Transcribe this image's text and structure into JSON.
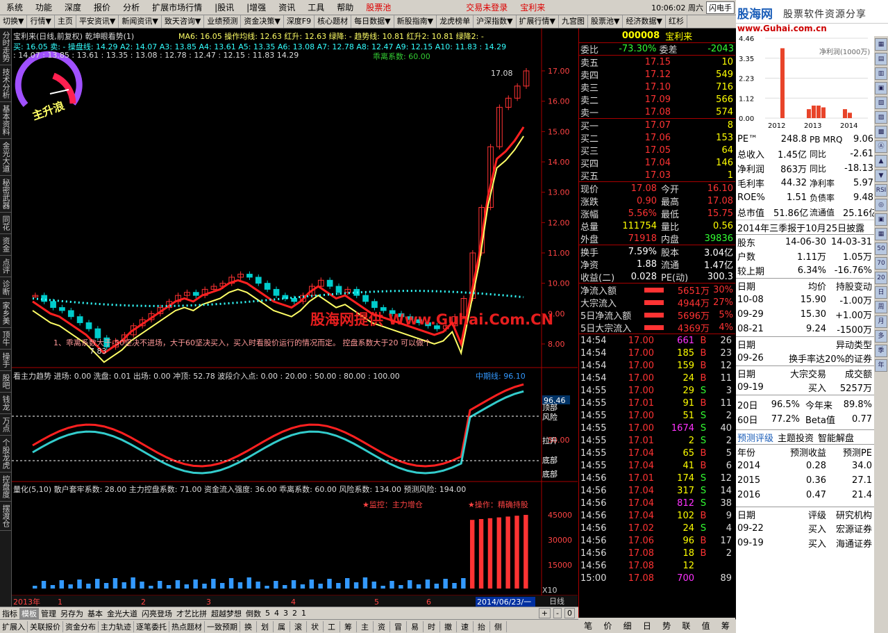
{
  "menu": [
    "系统",
    "功能",
    "深度",
    "报价",
    "分析",
    "扩展市场行情",
    "|股讯",
    "|增强",
    "资讯",
    "工具",
    "帮助"
  ],
  "menu_red": "股票池",
  "menu_login": "交易未登录",
  "menu_stock": "宝利来",
  "clock": "10:06:02 周六",
  "flash": "闪电手",
  "tabs": [
    "切换▼",
    "行情▼",
    "主页",
    "平安资讯▼",
    "新闻资讯▼",
    "致天咨询▼",
    "业绩预测",
    "资金决策▼",
    "深度F9",
    "核心题材",
    "每日数据▼",
    "新股指南▼",
    "龙虎榜单",
    "沪深指数▼",
    "扩展行情▼",
    "九宫图",
    "股票池▼",
    "经济数据▼",
    "红杉"
  ],
  "leftbar": [
    "分时走势",
    "技术分析",
    "基本资料",
    "金光大道",
    "秘密武器",
    "同花",
    "资金",
    "点评",
    "诊断",
    "家乡美",
    "顶牛",
    "操手",
    "股吧",
    "钱龙",
    "万点",
    "个股龙虎",
    "控盘度",
    "摆渡仓"
  ],
  "chart": {
    "title": "宝利来(日线,前复权) 乾坤眼看势(1)",
    "ma_line": "MA6: 16.05  操作均线: 12.63  红升: 12.63  绿降: -  趋势线: 10.81  红升2: 10.81  绿降2: -",
    "line2": "买: 16.05  卖: -   操盘线: 14.29  A2: 14.07  A3: 13.85  A4: 13.61  A5: 13.35  A6: 13.08  A7: 12.78  A8: 12.47  A9: 12.15  A10: 11.83  : 14.29",
    "line3": ": 14.07 : 13.85 : 13.61 : 13.35 : 13.08 : 12.78 : 12.47 : 12.15 : 11.83  14.29",
    "line4": "乖离系数: 60.00",
    "gauge": "主升浪",
    "hi_label": "17.08",
    "lo_label": "7.83",
    "note": "1、乖离系数大于-50坚决不进场，大于60坚决买入，买入时看股价运行的情况而定。    控盘系数大于20 可以做个",
    "watermark": "股海网提供 Www.Guhai.Com.CN",
    "yaxis": [
      "17.00",
      "16.00",
      "15.00",
      "14.00",
      "13.00",
      "12.00",
      "11.00",
      "10.00",
      "9.00",
      "8.00"
    ],
    "ind1": "看主力趋势   进场: 0.00   洗盘: 0.01   出场: 0.00   冲顶: 52.78   波段介入点: 0.00   : 20.00   : 50.00   : 80.00   : 100.00",
    "ind1_right": "中期线: 96.10",
    "ind1_y": [
      "96.46",
      "50.00"
    ],
    "ind1_labels": [
      "顶部",
      "风险",
      "拉升",
      "底部",
      "底部"
    ],
    "ind2": "量化(5,10)  散户套牢系数: 28.00  主力控盘系数: 71.00  资金流入强度: 36.00  乖离系数: 60.00          风险系数: 134.00  预测风险: 194.00",
    "ind2_watch": "★监控：主力增仓",
    "ind2_op": "★操作：精确持股",
    "ind2_y": [
      "45000",
      "30000",
      "15000"
    ],
    "ind2_x10": "X10",
    "dates": [
      "2013年",
      "1",
      "2",
      "3",
      "4",
      "5",
      "6"
    ],
    "date_hl": "2014/06/23/一",
    "period": "日线"
  },
  "bottom_tabs": [
    "指标",
    "模板",
    "管理",
    "另存为",
    "基本",
    "金光大道",
    "闪亮登场",
    "才艺比拼",
    "超越梦想",
    "倒数",
    "5",
    "4",
    "3",
    "2",
    "1"
  ],
  "bottom_ctrl": [
    "+",
    "-",
    "0"
  ],
  "bottom2": [
    "扩展入",
    "关联报价",
    "资金分布",
    "主力轨迹",
    "逐笔委托",
    "热点题材",
    "一致预期",
    "换",
    "划",
    "属",
    "滚",
    "状",
    "工",
    "筹",
    "主",
    "资",
    "冒",
    "易",
    "时",
    "撤",
    "速",
    "抬",
    "侧"
  ],
  "quote": {
    "code": "000008",
    "name": "宝利来",
    "weibi_label": "委比",
    "weibi": "-73.30%",
    "weicha_label": "委差",
    "weicha": "-2043",
    "sells": [
      {
        "l": "卖五",
        "p": "17.15",
        "v": "10"
      },
      {
        "l": "卖四",
        "p": "17.12",
        "v": "549"
      },
      {
        "l": "卖三",
        "p": "17.10",
        "v": "716"
      },
      {
        "l": "卖二",
        "p": "17.09",
        "v": "566"
      },
      {
        "l": "卖一",
        "p": "17.08",
        "v": "574"
      }
    ],
    "buys": [
      {
        "l": "买一",
        "p": "17.07",
        "v": "8"
      },
      {
        "l": "买二",
        "p": "17.06",
        "v": "153"
      },
      {
        "l": "买三",
        "p": "17.05",
        "v": "64"
      },
      {
        "l": "买四",
        "p": "17.04",
        "v": "146"
      },
      {
        "l": "买五",
        "p": "17.03",
        "v": "1"
      }
    ],
    "stats": [
      [
        "现价",
        "17.08",
        "今开",
        "16.10"
      ],
      [
        "涨跌",
        "0.90",
        "最高",
        "17.08"
      ],
      [
        "涨幅",
        "5.56%",
        "最低",
        "15.75"
      ],
      [
        "总量",
        "111754",
        "量比",
        "0.56"
      ],
      [
        "外盘",
        "71918",
        "内盘",
        "39836"
      ]
    ],
    "stats2": [
      [
        "换手",
        "7.59%",
        "股本",
        "3.04亿"
      ],
      [
        "净资",
        "1.88",
        "流通",
        "1.47亿"
      ],
      [
        "收益(二)",
        "0.028",
        "PE(动)",
        "300.3"
      ]
    ],
    "flows": [
      [
        "净流入额",
        "5651万",
        "30%"
      ],
      [
        "大宗流入",
        "4944万",
        "27%"
      ],
      [
        "5日净流入额",
        "5696万",
        "5%"
      ],
      [
        "5日大宗流入",
        "4369万",
        "4%"
      ]
    ],
    "ticks": [
      [
        "14:54",
        "17.00",
        "661",
        "B",
        "26"
      ],
      [
        "14:54",
        "17.00",
        "185",
        "B",
        "23"
      ],
      [
        "14:54",
        "17.00",
        "159",
        "B",
        "12"
      ],
      [
        "14:54",
        "17.00",
        "24",
        "B",
        "11"
      ],
      [
        "14:55",
        "17.00",
        "29",
        "S",
        "3"
      ],
      [
        "14:55",
        "17.01",
        "91",
        "B",
        "11"
      ],
      [
        "14:55",
        "17.00",
        "51",
        "S",
        "2"
      ],
      [
        "14:55",
        "17.00",
        "1674",
        "S",
        "40"
      ],
      [
        "14:55",
        "17.01",
        "2",
        "S",
        "2"
      ],
      [
        "14:55",
        "17.04",
        "65",
        "B",
        "5"
      ],
      [
        "14:55",
        "17.04",
        "41",
        "B",
        "6"
      ],
      [
        "14:56",
        "17.01",
        "174",
        "S",
        "12"
      ],
      [
        "14:56",
        "17.04",
        "317",
        "S",
        "14"
      ],
      [
        "14:56",
        "17.04",
        "812",
        "S",
        "38"
      ],
      [
        "14:56",
        "17.04",
        "102",
        "B",
        "9"
      ],
      [
        "14:56",
        "17.02",
        "24",
        "S",
        "4"
      ],
      [
        "14:56",
        "17.06",
        "96",
        "B",
        "17"
      ],
      [
        "14:56",
        "17.08",
        "18",
        "B",
        "2"
      ],
      [
        "14:56",
        "17.08",
        "12",
        "",
        ""
      ],
      [
        "15:00",
        "17.08",
        "700",
        "",
        "89"
      ]
    ],
    "tabs": [
      "笔",
      "价",
      "细",
      "日",
      "势",
      "联",
      "值",
      "筹"
    ]
  },
  "far": {
    "banner_logo": "股海网",
    "banner_site": "股票软件资源分享",
    "banner_url": "www.Guhai.com.cn",
    "bar_title": "净利润(1000万)",
    "bar_y": [
      "4.46",
      "3.35",
      "2.23",
      "1.12",
      "0.00"
    ],
    "bar_x": [
      "2012",
      "2013",
      "2014"
    ],
    "fin": [
      [
        "PE™",
        "248.8",
        "PB MRQ",
        "9.06"
      ],
      [
        "总收入",
        "1.45亿",
        "同比",
        "-2.61"
      ],
      [
        "净利润",
        "863万",
        "同比",
        "-18.13"
      ],
      [
        "毛利率",
        "44.32",
        "净利率",
        "5.97"
      ],
      [
        "ROE%",
        "1.51",
        "负债率",
        "9.48"
      ],
      [
        "总市值",
        "51.86亿",
        "流通值",
        "25.16亿"
      ]
    ],
    "report": "2014年三季报于10月25日披露",
    "holders_head": [
      "股东",
      "14-06-30",
      "14-03-31"
    ],
    "holders": [
      [
        "户数",
        "1.11万",
        "1.05万"
      ],
      [
        "较上期",
        "6.34%",
        "-16.76%"
      ]
    ],
    "flow_head": [
      "日期",
      "均价",
      "持股变动"
    ],
    "flow": [
      [
        "10-08",
        "15.90",
        "-1.00万"
      ],
      [
        "09-29",
        "15.30",
        "+1.00万"
      ],
      [
        "08-21",
        "9.24",
        "-1500万"
      ]
    ],
    "abn_head": [
      "日期",
      "异动类型"
    ],
    "abn": [
      [
        "09-26",
        "换手率达20%的证券"
      ]
    ],
    "big_head": [
      "日期",
      "大宗交易",
      "成交额"
    ],
    "big": [
      [
        "09-19",
        "买入",
        "5257万"
      ]
    ],
    "rank": [
      [
        "20日",
        "96.5%",
        "今年来",
        "89.8%"
      ],
      [
        "60日",
        "77.2%",
        "Beta值",
        "0.77"
      ]
    ],
    "fc_tabs": [
      "预测评级",
      "主题投资",
      "智能解盘"
    ],
    "fc_head": [
      "年份",
      "预测收益",
      "预测PE"
    ],
    "fc": [
      [
        "2014",
        "0.28",
        "34.0"
      ],
      [
        "2015",
        "0.36",
        "27.1"
      ],
      [
        "2016",
        "0.47",
        "21.4"
      ]
    ],
    "rt_head": [
      "日期",
      "评级",
      "研究机构"
    ],
    "rt": [
      [
        "09-22",
        "买入",
        "宏源证券"
      ],
      [
        "09-19",
        "买入",
        "海通证券"
      ]
    ],
    "icons": [
      "▦",
      "▤",
      "▥",
      "▣",
      "▧",
      "▨",
      "▩",
      "Ⓐ",
      "▲",
      "▼",
      "RSI",
      "◎",
      "▣",
      "▦",
      "50",
      "70",
      "20",
      "日",
      "周",
      "月",
      "多",
      "季",
      "年"
    ]
  },
  "colors": {
    "up": "#ff3333",
    "down": "#00cccc",
    "yellow": "#ffff00",
    "bg": "#000000",
    "grid": "#800000"
  }
}
